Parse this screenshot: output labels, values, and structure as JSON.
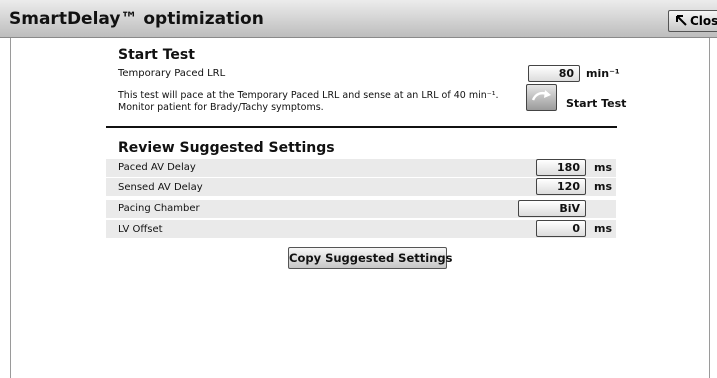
{
  "window": {
    "title": "SmartDelay™ optimization",
    "close_label": "Close"
  },
  "start_test": {
    "heading": "Start Test",
    "temp_paced_lrl_label": "Temporary Paced LRL",
    "temp_paced_lrl_value": "80",
    "temp_paced_lrl_unit": "min⁻¹",
    "description_line1": "This test will pace at the Temporary Paced LRL and sense at an LRL of 40 min⁻¹.",
    "description_line2": "Monitor patient for Brady/Tachy symptoms.",
    "start_label": "Start Test"
  },
  "review": {
    "heading": "Review Suggested Settings",
    "settings": [
      {
        "label": "Paced AV Delay",
        "value": "180",
        "unit": "ms"
      },
      {
        "label": "Sensed AV Delay",
        "value": "120",
        "unit": "ms"
      },
      {
        "label": "Pacing Chamber",
        "value": "BiV",
        "unit": ""
      },
      {
        "label": "LV Offset",
        "value": "0",
        "unit": "ms"
      }
    ],
    "copy_label": "Copy Suggested Settings"
  }
}
